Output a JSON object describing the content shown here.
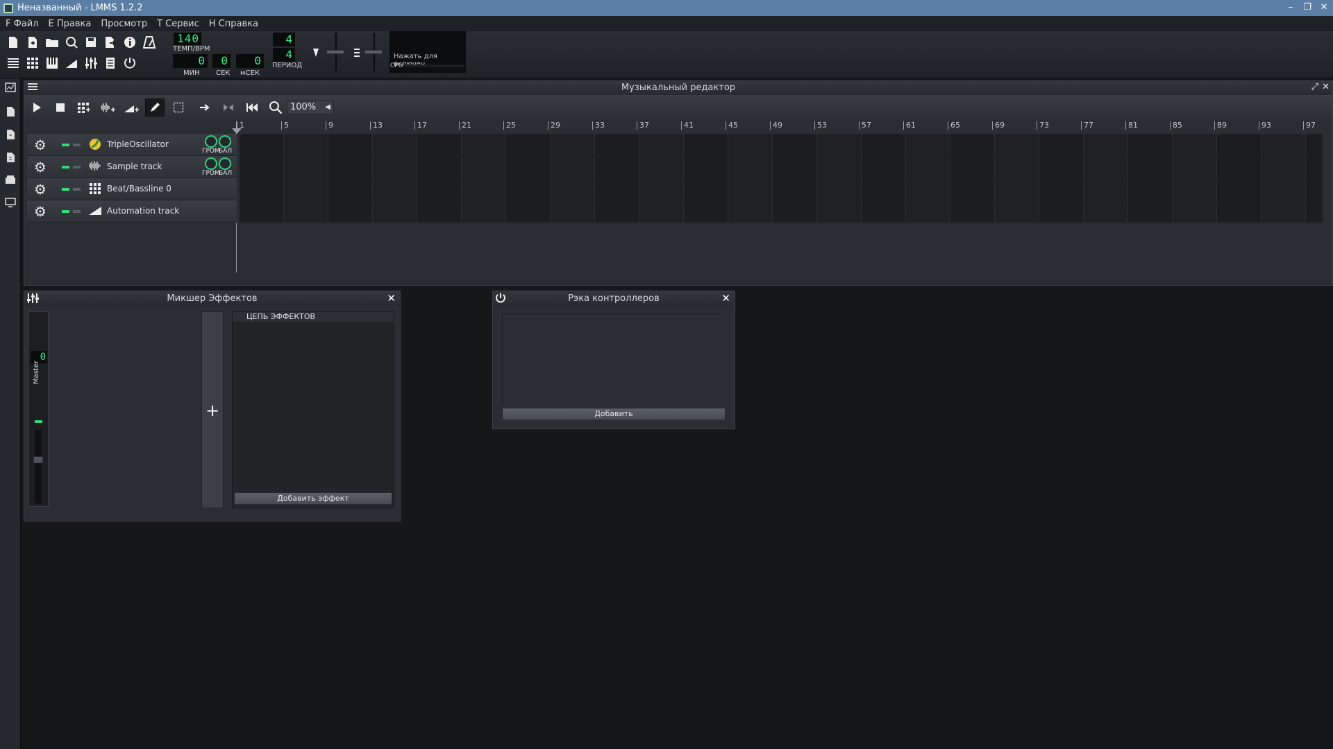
{
  "window": {
    "title": "Неназванный - LMMS 1.2.2",
    "controls": [
      "–",
      "❐",
      "✕"
    ]
  },
  "menu": [
    {
      "label": "F Файл"
    },
    {
      "label": "E Правка"
    },
    {
      "label": "Просмотр"
    },
    {
      "label": "T Сервис"
    },
    {
      "label": "H Справка"
    }
  ],
  "toolbar": {
    "tempo": {
      "value": "140",
      "label": "ТЕМП/BPM"
    },
    "time_sig": {
      "numerator": "4",
      "denominator": "4",
      "label": "ПЕРИОД"
    },
    "time": {
      "min": {
        "value": "0",
        "label": "МИН"
      },
      "sec": {
        "value": "0",
        "label": "СЕК"
      },
      "msec": {
        "value": "0",
        "label": "мСЕК"
      }
    },
    "cpu_hint": "Нажать для включен",
    "cpu_label": "CPU"
  },
  "song_editor": {
    "title": "Музыкальный редактор",
    "zoom": "100%",
    "bars": [
      "1",
      "5",
      "9",
      "13",
      "17",
      "21",
      "25",
      "29",
      "33",
      "37",
      "41",
      "45",
      "49",
      "53",
      "57",
      "61",
      "65",
      "69",
      "73",
      "77",
      "81",
      "85",
      "89",
      "93",
      "97"
    ],
    "tracks": [
      {
        "name": "TripleOscillator",
        "icon": "triple-oscillator-icon",
        "knobs": true
      },
      {
        "name": "Sample track",
        "icon": "waveform-icon",
        "knobs": true
      },
      {
        "name": "Beat/Bassline 0",
        "icon": "beat-grid-icon",
        "knobs": false
      },
      {
        "name": "Automation track",
        "icon": "automation-ramp-icon",
        "knobs": false
      }
    ],
    "knob_labels": {
      "volume": "ГРОМ",
      "pan": "БАЛ"
    }
  },
  "mixer": {
    "title": "Микшер Эффектов",
    "master_label": "Master",
    "master_value": "0",
    "fx_chain_label": "ЦЕПЬ ЭФФЕКТОВ",
    "add_effect": "Добавить эффект",
    "add_channel": "+"
  },
  "controller_rack": {
    "title": "Рэка контроллеров",
    "add": "Добавить"
  },
  "colors": {
    "accent_green": "#35f08a",
    "titlebar_blue": "#5b7fa4"
  }
}
